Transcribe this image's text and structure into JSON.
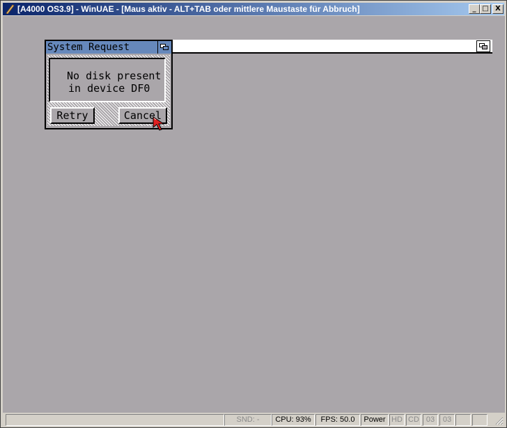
{
  "window": {
    "title": "[A4000 OS3.9] - WinUAE - [Maus aktiv - ALT+TAB oder mittlere Maustaste für Abbruch]",
    "controls": {
      "minimize": "_",
      "maximize": "□",
      "close": "X"
    }
  },
  "requester": {
    "title": "System Request",
    "message": [
      "No disk present",
      "in device DF0"
    ],
    "buttons": {
      "retry": "Retry",
      "cancel": "Cancel"
    }
  },
  "statusbar": {
    "snd": "SND: -",
    "cpu": "CPU: 93%",
    "fps": "FPS: 50.0",
    "power": "Power",
    "hd": "HD",
    "cd": "CD",
    "drive1": "03",
    "drive2": "03"
  },
  "colors": {
    "amiga_background": "#aaa6aa",
    "requester_title": "#6688bb",
    "win_title_start": "#0a246a",
    "win_title_end": "#a6caf0"
  },
  "icons": {
    "app": "winuae-icon",
    "depth": "depth-arrange-icon",
    "pointer": "amiga-mouse-pointer-icon"
  }
}
